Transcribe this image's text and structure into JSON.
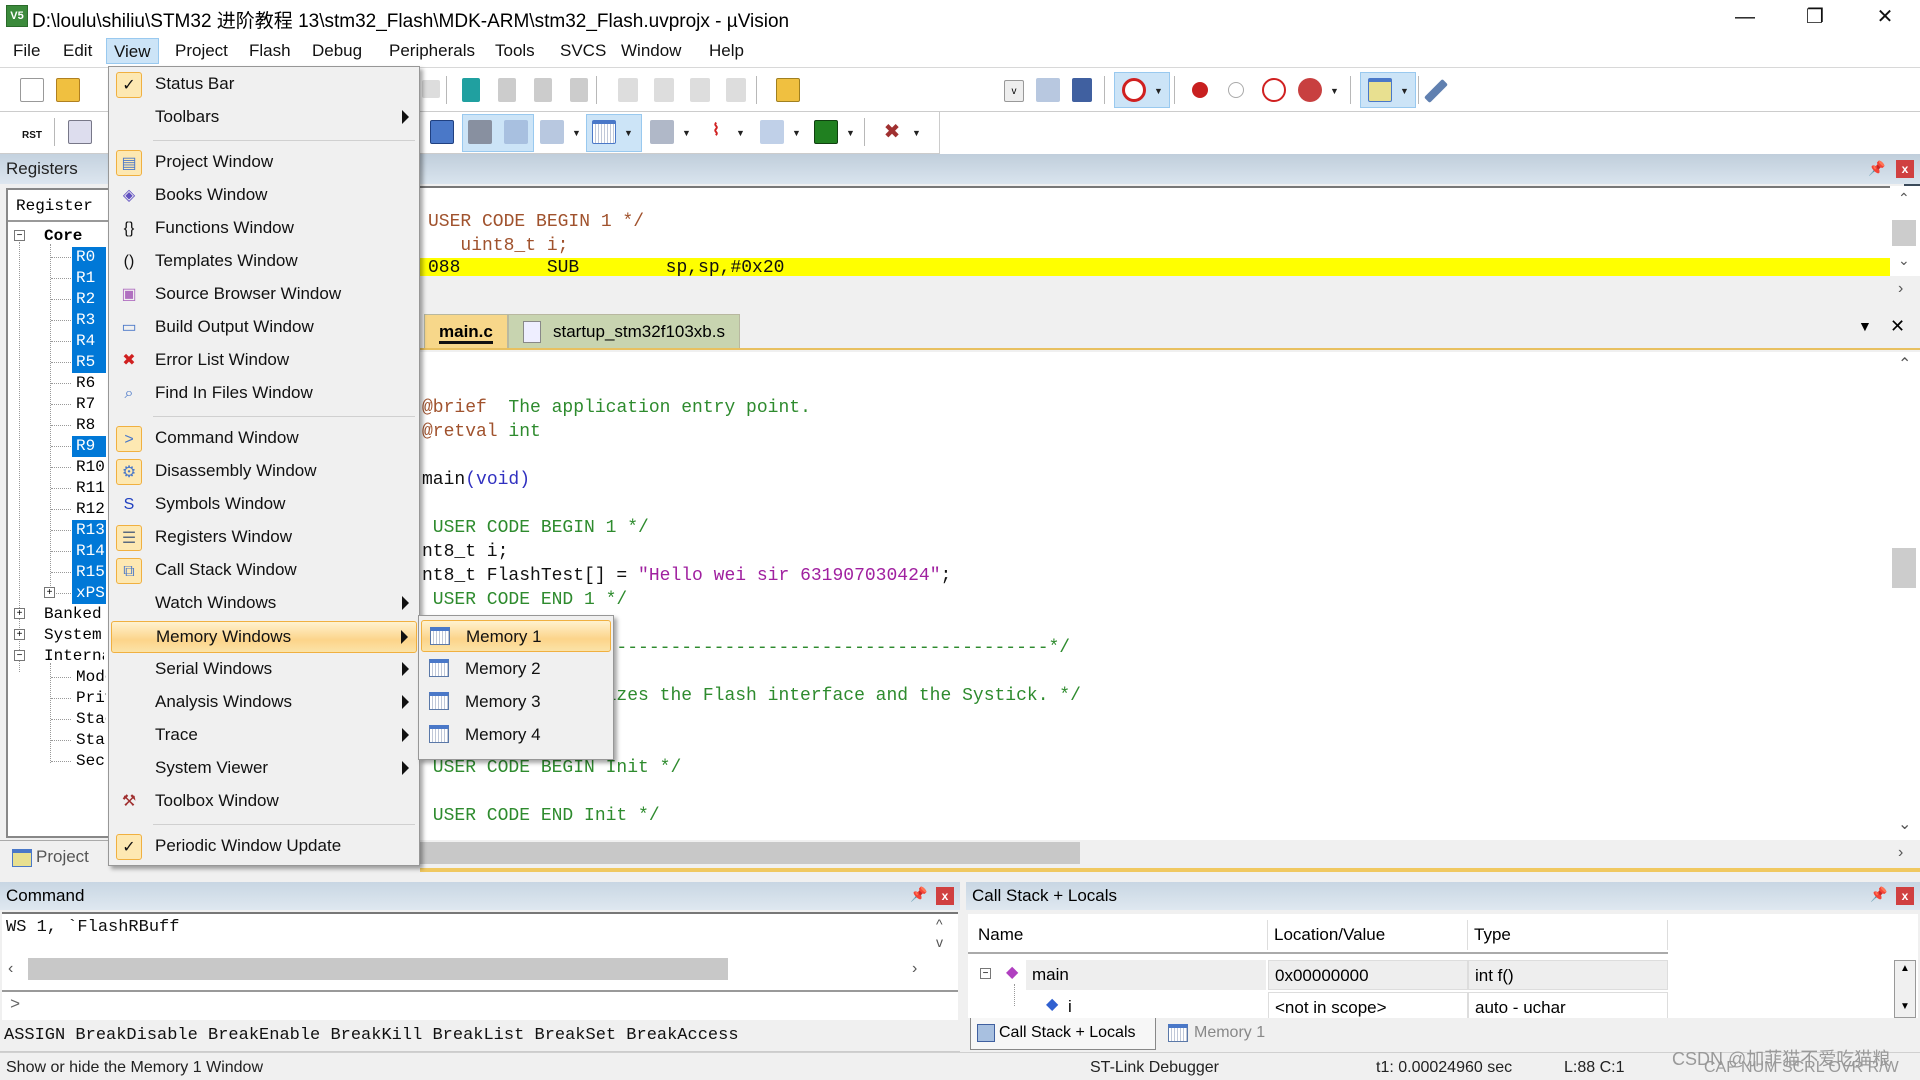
{
  "window": {
    "title": "D:\\loulu\\shiliu\\STM32 进阶教程 13\\stm32_Flash\\MDK-ARM\\stm32_Flash.uvprojx - µVision",
    "app_icon": "V5",
    "minimize": "—",
    "restore": "❐",
    "close": "✕"
  },
  "menubar": [
    "File",
    "Edit",
    "View",
    "Project",
    "Flash",
    "Debug",
    "Peripherals",
    "Tools",
    "SVCS",
    "Window",
    "Help"
  ],
  "registers_panel": {
    "title": "Registers",
    "column": "Register",
    "core_label": "Core",
    "core_regs": [
      {
        "name": "R0",
        "selected": true
      },
      {
        "name": "R1",
        "selected": true
      },
      {
        "name": "R2",
        "selected": true
      },
      {
        "name": "R3",
        "selected": true
      },
      {
        "name": "R4",
        "selected": true
      },
      {
        "name": "R5",
        "selected": true
      },
      {
        "name": "R6",
        "selected": false
      },
      {
        "name": "R7",
        "selected": false
      },
      {
        "name": "R8",
        "selected": false
      },
      {
        "name": "R9",
        "selected": true
      },
      {
        "name": "R10",
        "selected": false
      },
      {
        "name": "R11",
        "selected": false
      },
      {
        "name": "R12",
        "selected": false
      },
      {
        "name": "R13",
        "selected": true
      },
      {
        "name": "R14",
        "selected": true
      },
      {
        "name": "R15",
        "selected": true
      },
      {
        "name": "xPSR",
        "selected": true
      }
    ],
    "groups": [
      "Banked",
      "System",
      "Internal"
    ],
    "internal_items": [
      "Mode",
      "Privilege",
      "Stack",
      "States",
      "Sec"
    ],
    "bottom_tab": "Project"
  },
  "view_menu": {
    "items": [
      {
        "label": "Status Bar",
        "icon": "check-icon",
        "checked": true
      },
      {
        "label": "Toolbars",
        "submenu": true
      },
      {
        "separator": true
      },
      {
        "label": "Project Window",
        "icon": "project-window-icon",
        "checked": true
      },
      {
        "label": "Books Window",
        "icon": "books-icon"
      },
      {
        "label": "Functions Window",
        "icon": "braces-icon"
      },
      {
        "label": "Templates Window",
        "icon": "templates-icon"
      },
      {
        "label": "Source Browser Window",
        "icon": "source-browser-icon"
      },
      {
        "label": "Build Output Window",
        "icon": "build-output-icon"
      },
      {
        "label": "Error List Window",
        "icon": "error-list-icon"
      },
      {
        "label": "Find In Files Window",
        "icon": "find-in-files-icon"
      },
      {
        "separator": true
      },
      {
        "label": "Command Window",
        "icon": "command-window-icon",
        "checked": true
      },
      {
        "label": "Disassembly Window",
        "icon": "disassembly-icon",
        "checked": true
      },
      {
        "label": "Symbols Window",
        "icon": "symbols-icon"
      },
      {
        "label": "Registers Window",
        "icon": "registers-icon",
        "checked": true
      },
      {
        "label": "Call Stack Window",
        "icon": "call-stack-icon",
        "checked": true
      },
      {
        "label": "Watch Windows",
        "submenu": true
      },
      {
        "label": "Memory Windows",
        "submenu": true,
        "highlighted": true
      },
      {
        "label": "Serial Windows",
        "submenu": true
      },
      {
        "label": "Analysis Windows",
        "submenu": true
      },
      {
        "label": "Trace",
        "submenu": true
      },
      {
        "label": "System Viewer",
        "submenu": true
      },
      {
        "label": "Toolbox Window",
        "icon": "toolbox-icon"
      },
      {
        "separator": true
      },
      {
        "label": "Periodic Window Update",
        "icon": "check-icon",
        "checked": true
      }
    ]
  },
  "memory_submenu": {
    "items": [
      {
        "label": "Memory 1",
        "highlighted": true
      },
      {
        "label": "Memory 2"
      },
      {
        "label": "Memory 3"
      },
      {
        "label": "Memory 4"
      }
    ]
  },
  "disassembly": {
    "lines": [
      {
        "text": "USER CODE BEGIN 1 */",
        "color": "brown"
      },
      {
        "text": "   uint8_t i;",
        "color": "brown"
      },
      {
        "text": "088        SUB        sp,sp,#0x20",
        "color": "dark",
        "highlight": true
      }
    ]
  },
  "editor": {
    "tabs": [
      {
        "label": "main.c",
        "active": true
      },
      {
        "label": "startup_stm32f103xb.s",
        "active": false
      }
    ],
    "lines": [
      {
        "parts": [
          {
            "t": "@brief  ",
            "c": "brown"
          },
          {
            "t": "The application entry point.",
            "c": "green"
          }
        ]
      },
      {
        "parts": [
          {
            "t": "@retval ",
            "c": "brown"
          },
          {
            "t": "int",
            "c": "green"
          }
        ]
      },
      {
        "parts": []
      },
      {
        "parts": [
          {
            "t": "main",
            "c": "dark"
          },
          {
            "t": "(void)",
            "c": "blue"
          }
        ]
      },
      {
        "parts": []
      },
      {
        "parts": [
          {
            "t": " USER CODE BEGIN 1 */",
            "c": "green"
          }
        ]
      },
      {
        "parts": [
          {
            "t": "nt8_t i;",
            "c": "dark"
          }
        ]
      },
      {
        "parts": [
          {
            "t": "nt8_t FlashTest[] = ",
            "c": "dark"
          },
          {
            "t": "\"Hello wei sir 631907030424\"",
            "c": "purple"
          },
          {
            "t": ";",
            "c": "dark"
          }
        ]
      },
      {
        "parts": [
          {
            "t": " USER CODE END 1 */",
            "c": "green"
          }
        ]
      },
      {
        "parts": []
      },
      {
        "parts": [
          {
            "t": "n---------------------------------------------------------*/",
            "c": "green"
          }
        ]
      },
      {
        "parts": []
      },
      {
        "parts": [
          {
            "t": "ipherals, Initializes the Flash interface and the Systick. */",
            "c": "green"
          }
        ]
      },
      {
        "parts": []
      },
      {
        "parts": []
      },
      {
        "parts": [
          {
            "t": " USER CODE BEGIN Init */",
            "c": "green"
          }
        ]
      },
      {
        "parts": []
      },
      {
        "parts": [
          {
            "t": " USER CODE END Init */",
            "c": "green"
          }
        ]
      }
    ]
  },
  "command_panel": {
    "title": "Command",
    "output": "WS 1, `FlashRBuff",
    "prompt": ">",
    "help_line": "ASSIGN BreakDisable BreakEnable BreakKill BreakList BreakSet BreakAccess"
  },
  "callstack_panel": {
    "title": "Call Stack + Locals",
    "columns": [
      "Name",
      "Location/Value",
      "Type"
    ],
    "rows": [
      {
        "name": "main",
        "value": "0x00000000",
        "type": "int f()"
      },
      {
        "name": "i",
        "value": "<not in scope>",
        "type": "auto - uchar"
      }
    ],
    "tabs": [
      "Call Stack + Locals",
      "Memory 1"
    ]
  },
  "statusbar": {
    "hint": "Show or hide the Memory 1 Window",
    "debugger": "ST-Link Debugger",
    "time": "t1: 0.00024960 sec",
    "position": "L:88 C:1",
    "indicators": "CAP  NUM  SCRL  OVR  R/W",
    "watermark": "CSDN @加菲猫不爱吃猫粮"
  }
}
